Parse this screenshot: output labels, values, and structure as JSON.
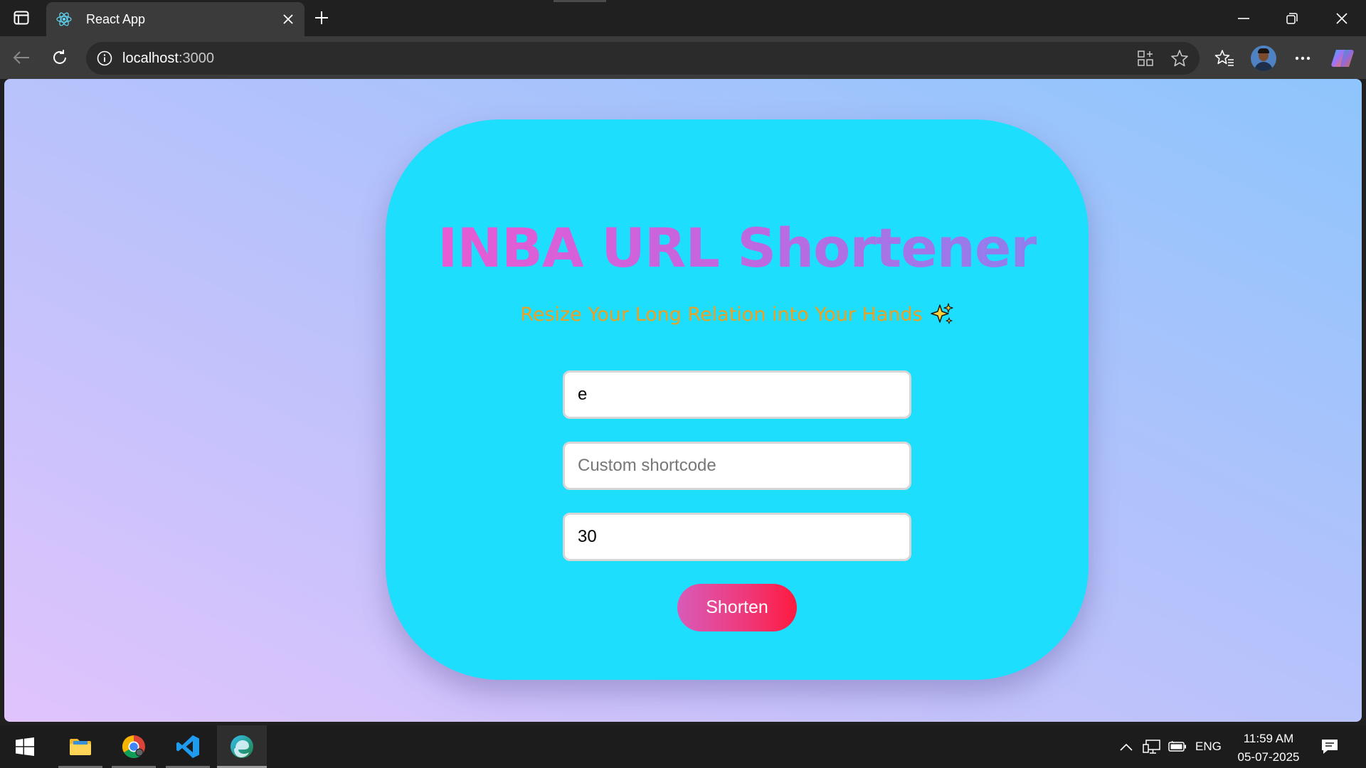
{
  "browser": {
    "tab": {
      "title": "React App",
      "favicon": "react-logo-icon"
    },
    "address_bar": {
      "host": "localhost",
      "port": ":3000"
    },
    "icons": [
      "tab-actions-icon",
      "close-icon",
      "new-tab-icon",
      "minimize-icon",
      "restore-icon",
      "back-icon",
      "refresh-icon",
      "info-icon",
      "app-available-icon",
      "favorite-star-icon",
      "favorites-icon",
      "profile-avatar",
      "more-icon",
      "copilot-icon"
    ]
  },
  "app": {
    "title": "INBA URL Shortener",
    "subtitle": "Resize Your Long Relation into Your Hands",
    "subtitle_icon": "sparkle-icon",
    "url_input": {
      "value": "e"
    },
    "shortcode_input": {
      "value": "",
      "placeholder": "Custom shortcode"
    },
    "validity_input": {
      "value": "30"
    },
    "shorten_button": "Shorten"
  },
  "colors": {
    "page_gradient": [
      "#e0c3fc",
      "#8ec5fc"
    ],
    "card": "#1ddffd",
    "title_gradient": [
      "#e85bd3",
      "#8f7fee"
    ],
    "subtitle": "#f0a020",
    "button_gradient": [
      "#d85bb8",
      "#ff1a40"
    ]
  },
  "taskbar": {
    "apps": [
      "start-icon",
      "file-explorer-icon",
      "chrome-icon",
      "vscode-icon",
      "edge-icon"
    ],
    "tray": {
      "language": "ENG",
      "time": "11:59 AM",
      "date": "05-07-2025"
    }
  }
}
